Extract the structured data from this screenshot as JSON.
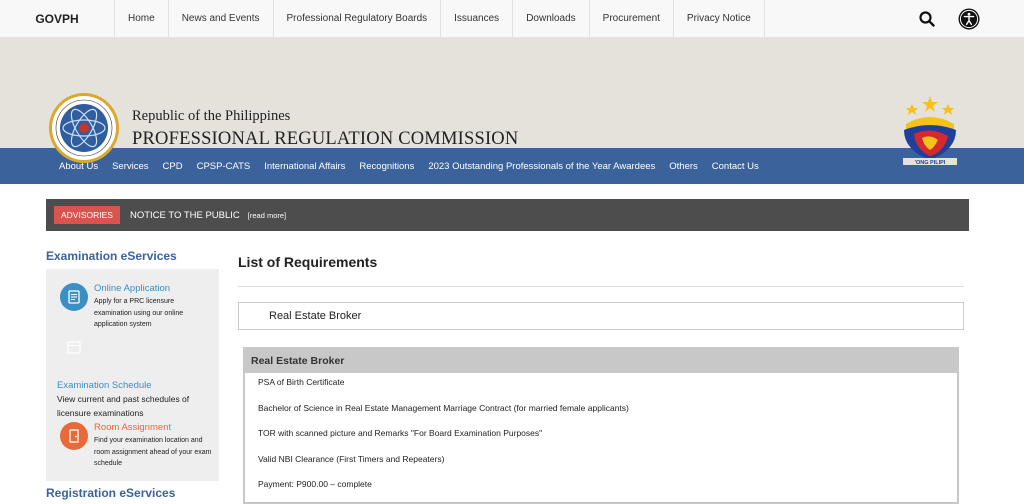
{
  "topbar": {
    "brand": "GOVPH",
    "links": [
      "Home",
      "News and Events",
      "Professional Regulatory Boards",
      "Issuances",
      "Downloads",
      "Procurement",
      "Privacy Notice"
    ],
    "icons": [
      "search-icon",
      "accessibility-icon"
    ]
  },
  "masthead": {
    "subtitle": "Republic of the Philippines",
    "title": "PROFESSIONAL REGULATION COMMISSION",
    "seal_text": "PROFESSIONAL REGULATION COMMISSION · REPUBLIC OF THE PHILIPPINES",
    "bp_logo_text": "BAGONG PILIPINAS"
  },
  "mainnav": {
    "items": [
      "About Us",
      "Services",
      "CPD",
      "CPSP-CATS",
      "International Affairs",
      "Recognitions",
      "2023 Outstanding Professionals of the Year Awardees",
      "Others",
      "Contact Us"
    ]
  },
  "advisory": {
    "badge": "ADVISORIES",
    "text": "NOTICE TO THE PUBLIC",
    "more": "[read more]"
  },
  "sidebar": {
    "exam_heading": "Examination eServices",
    "online_app": {
      "title": "Online Application",
      "desc": "Apply for a PRC licensure examination using our online application system"
    },
    "exam_schedule": {
      "title": "Examination Schedule",
      "desc": "View current and past schedules of licensure examinations"
    },
    "room_assignment": {
      "title": "Room Assignment",
      "desc": "Find your examination location and room assignment ahead of your exam schedule"
    },
    "reg_heading": "Registration eServices"
  },
  "main": {
    "title": "List of Requirements",
    "selected_profession": "Real Estate Broker",
    "panel_title": "Real Estate Broker",
    "requirements": [
      "PSA of Birth Certificate",
      "Bachelor of Science in Real Estate Management Marriage Contract (for married female applicants)",
      "TOR with scanned picture and Remarks \"For Board Examination Purposes\"",
      "Valid NBI Clearance (First Timers and Repeaters)",
      "Payment: P900.00 – complete"
    ]
  },
  "colors": {
    "nav_blue": "#3b629b",
    "advisory_red": "#d9534f",
    "link_blue": "#3a8fc4",
    "accent_orange": "#e8693a"
  }
}
